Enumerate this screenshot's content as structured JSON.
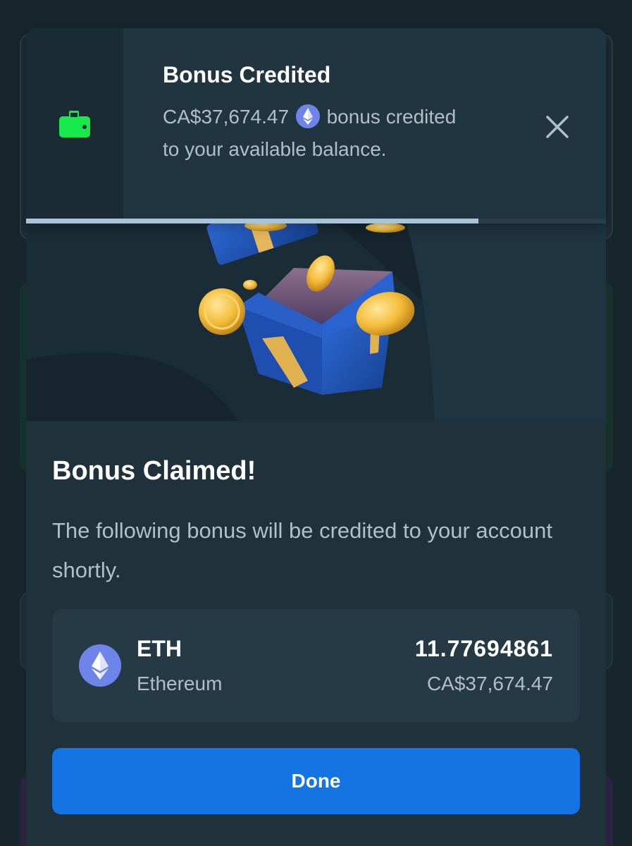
{
  "toast": {
    "title": "Bonus Credited",
    "amount": "CA$37,674.47",
    "message_suffix": "bonus",
    "message_rest": "credited to your available balance.",
    "icon": "wallet-icon",
    "currency_icon": "ethereum-icon",
    "close_icon": "close-icon",
    "progress": 0.78,
    "accent_color": "#17e84b"
  },
  "modal": {
    "title": "Bonus Claimed!",
    "description": "The following bonus will be credited to your account shortly.",
    "hero_image": "gift-box-with-coins",
    "coin": {
      "symbol": "ETH",
      "name": "Ethereum",
      "amount": "11.77694861",
      "fiat_value": "CA$37,674.47",
      "icon": "ethereum-icon"
    },
    "done_label": "Done",
    "button_color": "#1474e3"
  }
}
